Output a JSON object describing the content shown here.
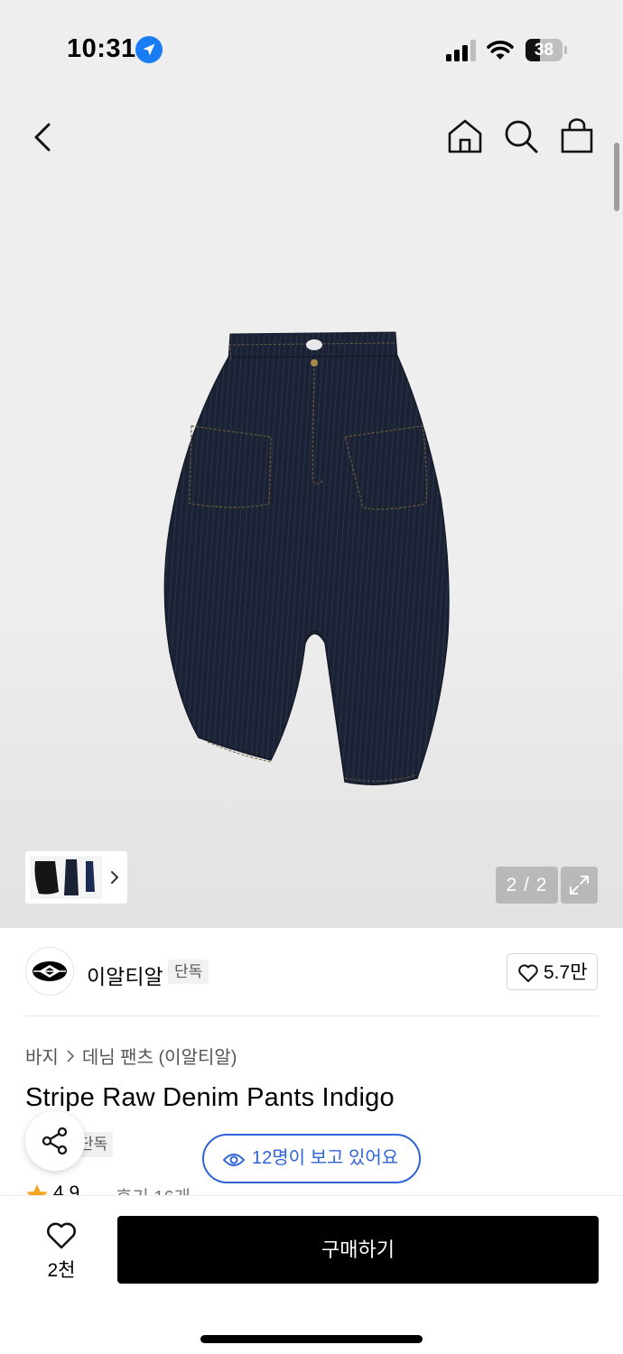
{
  "status_bar": {
    "time": "10:31",
    "battery_percent": 38,
    "battery_label": "38"
  },
  "nav": {
    "back": "chevron-left-icon",
    "home": "home-icon",
    "search": "search-icon",
    "cart": "shopping-bag-icon"
  },
  "gallery": {
    "counter": "2 / 2",
    "current_page": 2,
    "total_pages": 2
  },
  "brand": {
    "name": "이알티알",
    "tag": "단독",
    "likes": "5.7만"
  },
  "product": {
    "breadcrumb": [
      "바지",
      "데님 팬츠 (이알티알)"
    ],
    "title": "Stripe Raw Denim Pants Indigo",
    "tag": "단독",
    "viewers_text": "12명이 보고 있어요",
    "rating": "4.9",
    "reviews": "후기 16개"
  },
  "bottom_bar": {
    "like_count": "2천",
    "buy_label": "구매하기"
  },
  "colors": {
    "accent_blue": "#2f63d8",
    "star": "#f5a623",
    "denim": "#1c2336"
  }
}
